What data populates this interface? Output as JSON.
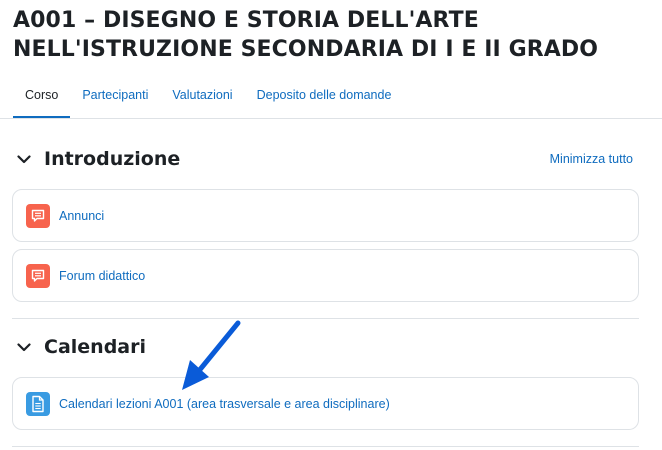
{
  "course": {
    "title": "A001 – DISEGNO E STORIA DELL'ARTE NELL'ISTRUZIONE SECONDARIA DI I E II GRADO"
  },
  "tabs": [
    {
      "label": "Corso",
      "active": true
    },
    {
      "label": "Partecipanti",
      "active": false
    },
    {
      "label": "Valutazioni",
      "active": false
    },
    {
      "label": "Deposito delle domande",
      "active": false
    }
  ],
  "collapse_all_label": "Minimizza tutto",
  "sections": [
    {
      "title": "Introduzione",
      "icon": "chevron-down-icon",
      "activities": [
        {
          "label": "Annunci",
          "icon": "forum-icon"
        },
        {
          "label": "Forum didattico",
          "icon": "forum-icon"
        }
      ]
    },
    {
      "title": "Calendari",
      "icon": "chevron-down-icon",
      "activities": [
        {
          "label": "Calendari lezioni A001 (area trasversale e area disciplinare)",
          "icon": "document-icon"
        }
      ]
    }
  ],
  "colors": {
    "link": "#0f6cbf",
    "forum_icon_bg": "#f7634d",
    "resource_icon_bg": "#399be2",
    "annotation_arrow": "#0a5bd8"
  },
  "annotation": {
    "icon": "arrow-annotation-icon"
  }
}
